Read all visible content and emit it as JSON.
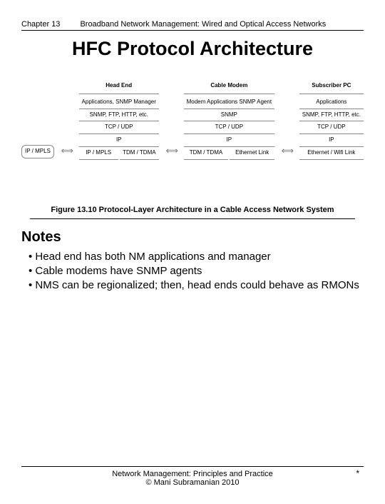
{
  "header": {
    "chapter": "Chapter 13",
    "course": "Broadband Network Management: Wired and Optical Access Networks"
  },
  "title": "HFC Protocol Architecture",
  "diagram": {
    "side_box": "IP / MPLS",
    "arrow": "⟺",
    "stacks": [
      {
        "title": "Head End",
        "rows": [
          "Applications, SNMP Manager",
          "SNMP, FTP, HTTP, etc.",
          "TCP / UDP",
          "IP"
        ],
        "pair": [
          "IP / MPLS",
          "TDM / TDMA"
        ]
      },
      {
        "title": "Cable Modem",
        "rows": [
          "Modem Applications SNMP Agent",
          "SNMP",
          "TCP / UDP",
          "IP"
        ],
        "pair": [
          "TDM / TDMA",
          "Ethernet Link"
        ]
      },
      {
        "title": "Subscriber PC",
        "rows": [
          "Applications",
          "SNMP, FTP, HTTP, etc.",
          "TCP / UDP",
          "IP"
        ],
        "pair": [
          "Ethernet / Wifi Link"
        ]
      }
    ]
  },
  "caption": "Figure 13.10  Protocol-Layer Architecture in a Cable Access Network System",
  "notes_heading": "Notes",
  "notes": [
    "Head end has both NM applications and manager",
    "Cable modems have SNMP agents",
    "NMS can be regionalized; then, head ends could behave as RMONs"
  ],
  "footer": {
    "line1": "Network Management: Principles and Practice",
    "line2": "©  Mani Subramanian 2010",
    "mark": "*"
  }
}
